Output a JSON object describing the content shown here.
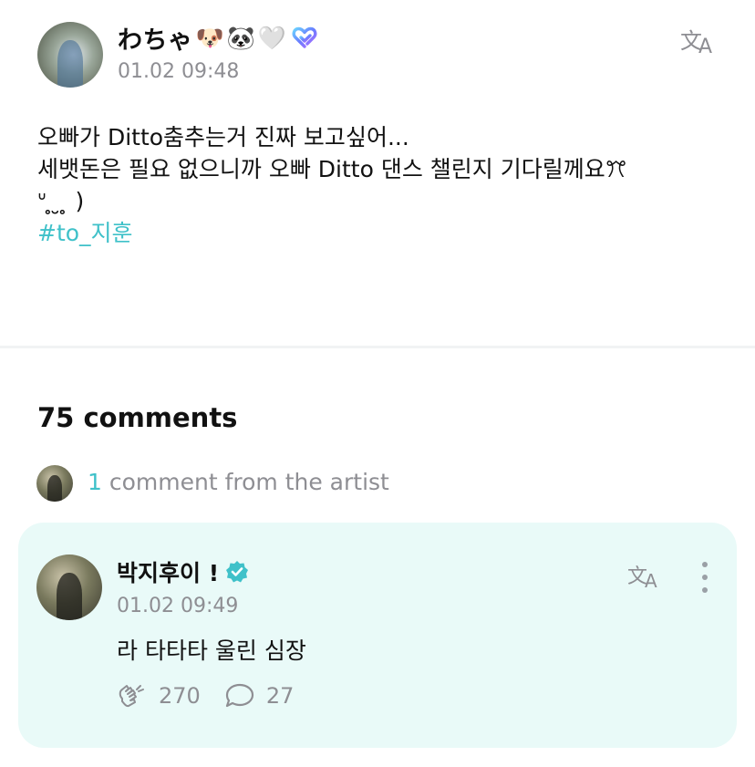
{
  "post": {
    "author": "わちゃ",
    "author_emojis": [
      "🐶",
      "🐼",
      "🤍"
    ],
    "badge_icon": "heart-badge-icon",
    "time": "01.02 09:48",
    "translate_icon": "translate-icon",
    "lines": [
      "오빠가 Ditto춤추는거 진짜 보고싶어...",
      "세뱃돈은 필요 없으니까 오빠 Ditto 댄스 챌린지 기다릴께요ꔫ",
      "ᐡ ̥ ̮  ̥ )"
    ],
    "hashtag": "#to_지훈"
  },
  "comments": {
    "count_label": "75 comments",
    "artist_count": "1",
    "artist_label": " comment from the artist"
  },
  "artist_comment": {
    "author": "박지후이 !",
    "verified_icon": "verified-badge-icon",
    "time": "01.02 09:49",
    "text": "라 타타타 울린 심장",
    "likes": "270",
    "replies": "27"
  },
  "colors": {
    "accent": "#3fc1c9",
    "card_bg": "#e9faf8",
    "muted": "#8e8e93"
  }
}
